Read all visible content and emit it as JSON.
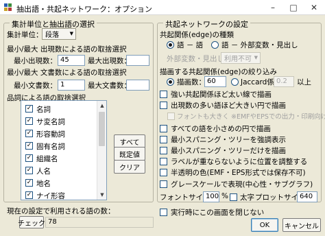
{
  "window": {
    "title": "抽出語・共起ネットワーク：オプション",
    "minimize_glyph": "–",
    "maximize_glyph": "□",
    "close_glyph": "✕"
  },
  "left_group": {
    "title": "集計単位と抽出語の選択",
    "unit_label": "集計単位：",
    "unit_value": "段落",
    "freq_section_label": "最小/最大 出現数による語の取捨選択",
    "min_freq_label": "最小出現数：",
    "min_freq_value": "45",
    "max_freq_label": "最大出現数：",
    "max_freq_value": "",
    "docs_section_label": "最小/最大 文書数による語の取捨選択",
    "min_docs_label": "最小文書数：",
    "min_docs_value": "1",
    "max_docs_label": "最大文書数：",
    "max_docs_value": "",
    "pos_section_label": "品詞による語の取捨選択",
    "pos_items": [
      {
        "label": "名詞",
        "checked": true
      },
      {
        "label": "サ変名詞",
        "checked": true
      },
      {
        "label": "形容動詞",
        "checked": true
      },
      {
        "label": "固有名詞",
        "checked": true
      },
      {
        "label": "組織名",
        "checked": true
      },
      {
        "label": "人名",
        "checked": true
      },
      {
        "label": "地名",
        "checked": true
      },
      {
        "label": "ナイ形容",
        "checked": true
      }
    ],
    "select_all_button": "すべて",
    "default_button": "既定値",
    "clear_button": "クリア",
    "count_label": "現在の設定で利用される語の数：",
    "check_button": "チェック",
    "count_value": "78"
  },
  "right_group": {
    "title": "共起ネットワークの設定",
    "edge_type_label": "共起関係(edge)の種類",
    "radio_word_word": "語 － 語",
    "radio_word_var": "語 － 外部変数・見出し",
    "var_select_label": "外部変数・見出し：",
    "var_select_value": "利用不可",
    "edge_filter_label": "描画する共起関係(edge)の絞り込み",
    "radio_draw_count": "描画数：",
    "draw_count_value": "60",
    "radio_jaccard": "Jaccard係数：",
    "jaccard_value": "0.2",
    "jaccard_suffix": "以上",
    "options": [
      {
        "label": "強い共起関係ほど太い線で描画",
        "checked": false,
        "disabled": false
      },
      {
        "label": "出現数の多い語ほど大きい円で描画",
        "checked": false,
        "disabled": false
      },
      {
        "label": "フォントも大きく ※EMFやEPSでの出力・印刷向け",
        "checked": false,
        "disabled": true
      },
      {
        "label": "すべての語を小さめの円で描画",
        "checked": false,
        "disabled": false
      },
      {
        "label": "最小スパニング・ツリーを強調表示",
        "checked": false,
        "disabled": false
      },
      {
        "label": "最小スパニング・ツリーだけを描画",
        "checked": false,
        "disabled": false
      },
      {
        "label": "ラベルが重ならないように位置を調整する",
        "checked": false,
        "disabled": false
      },
      {
        "label": "半透明の色(EMF・EPS形式では保存不可)",
        "checked": false,
        "disabled": false
      },
      {
        "label": "グレースケールで表現(中心性・サブグラフ)",
        "checked": false,
        "disabled": false
      }
    ],
    "font_size_label": "フォントサイズ：",
    "font_size_value": "100",
    "font_size_unit": "%",
    "bold_label": "太字",
    "plot_size_label": "プロットサイズ：",
    "plot_size_value": "640"
  },
  "bottom": {
    "no_close_label": "実行時にこの画面を閉じない",
    "ok_button": "OK",
    "cancel_button": "キャンセル"
  },
  "icons": {
    "checkmark": "✓",
    "dropdown": "▼",
    "scroll_up": "▲",
    "scroll_down": "▼"
  }
}
